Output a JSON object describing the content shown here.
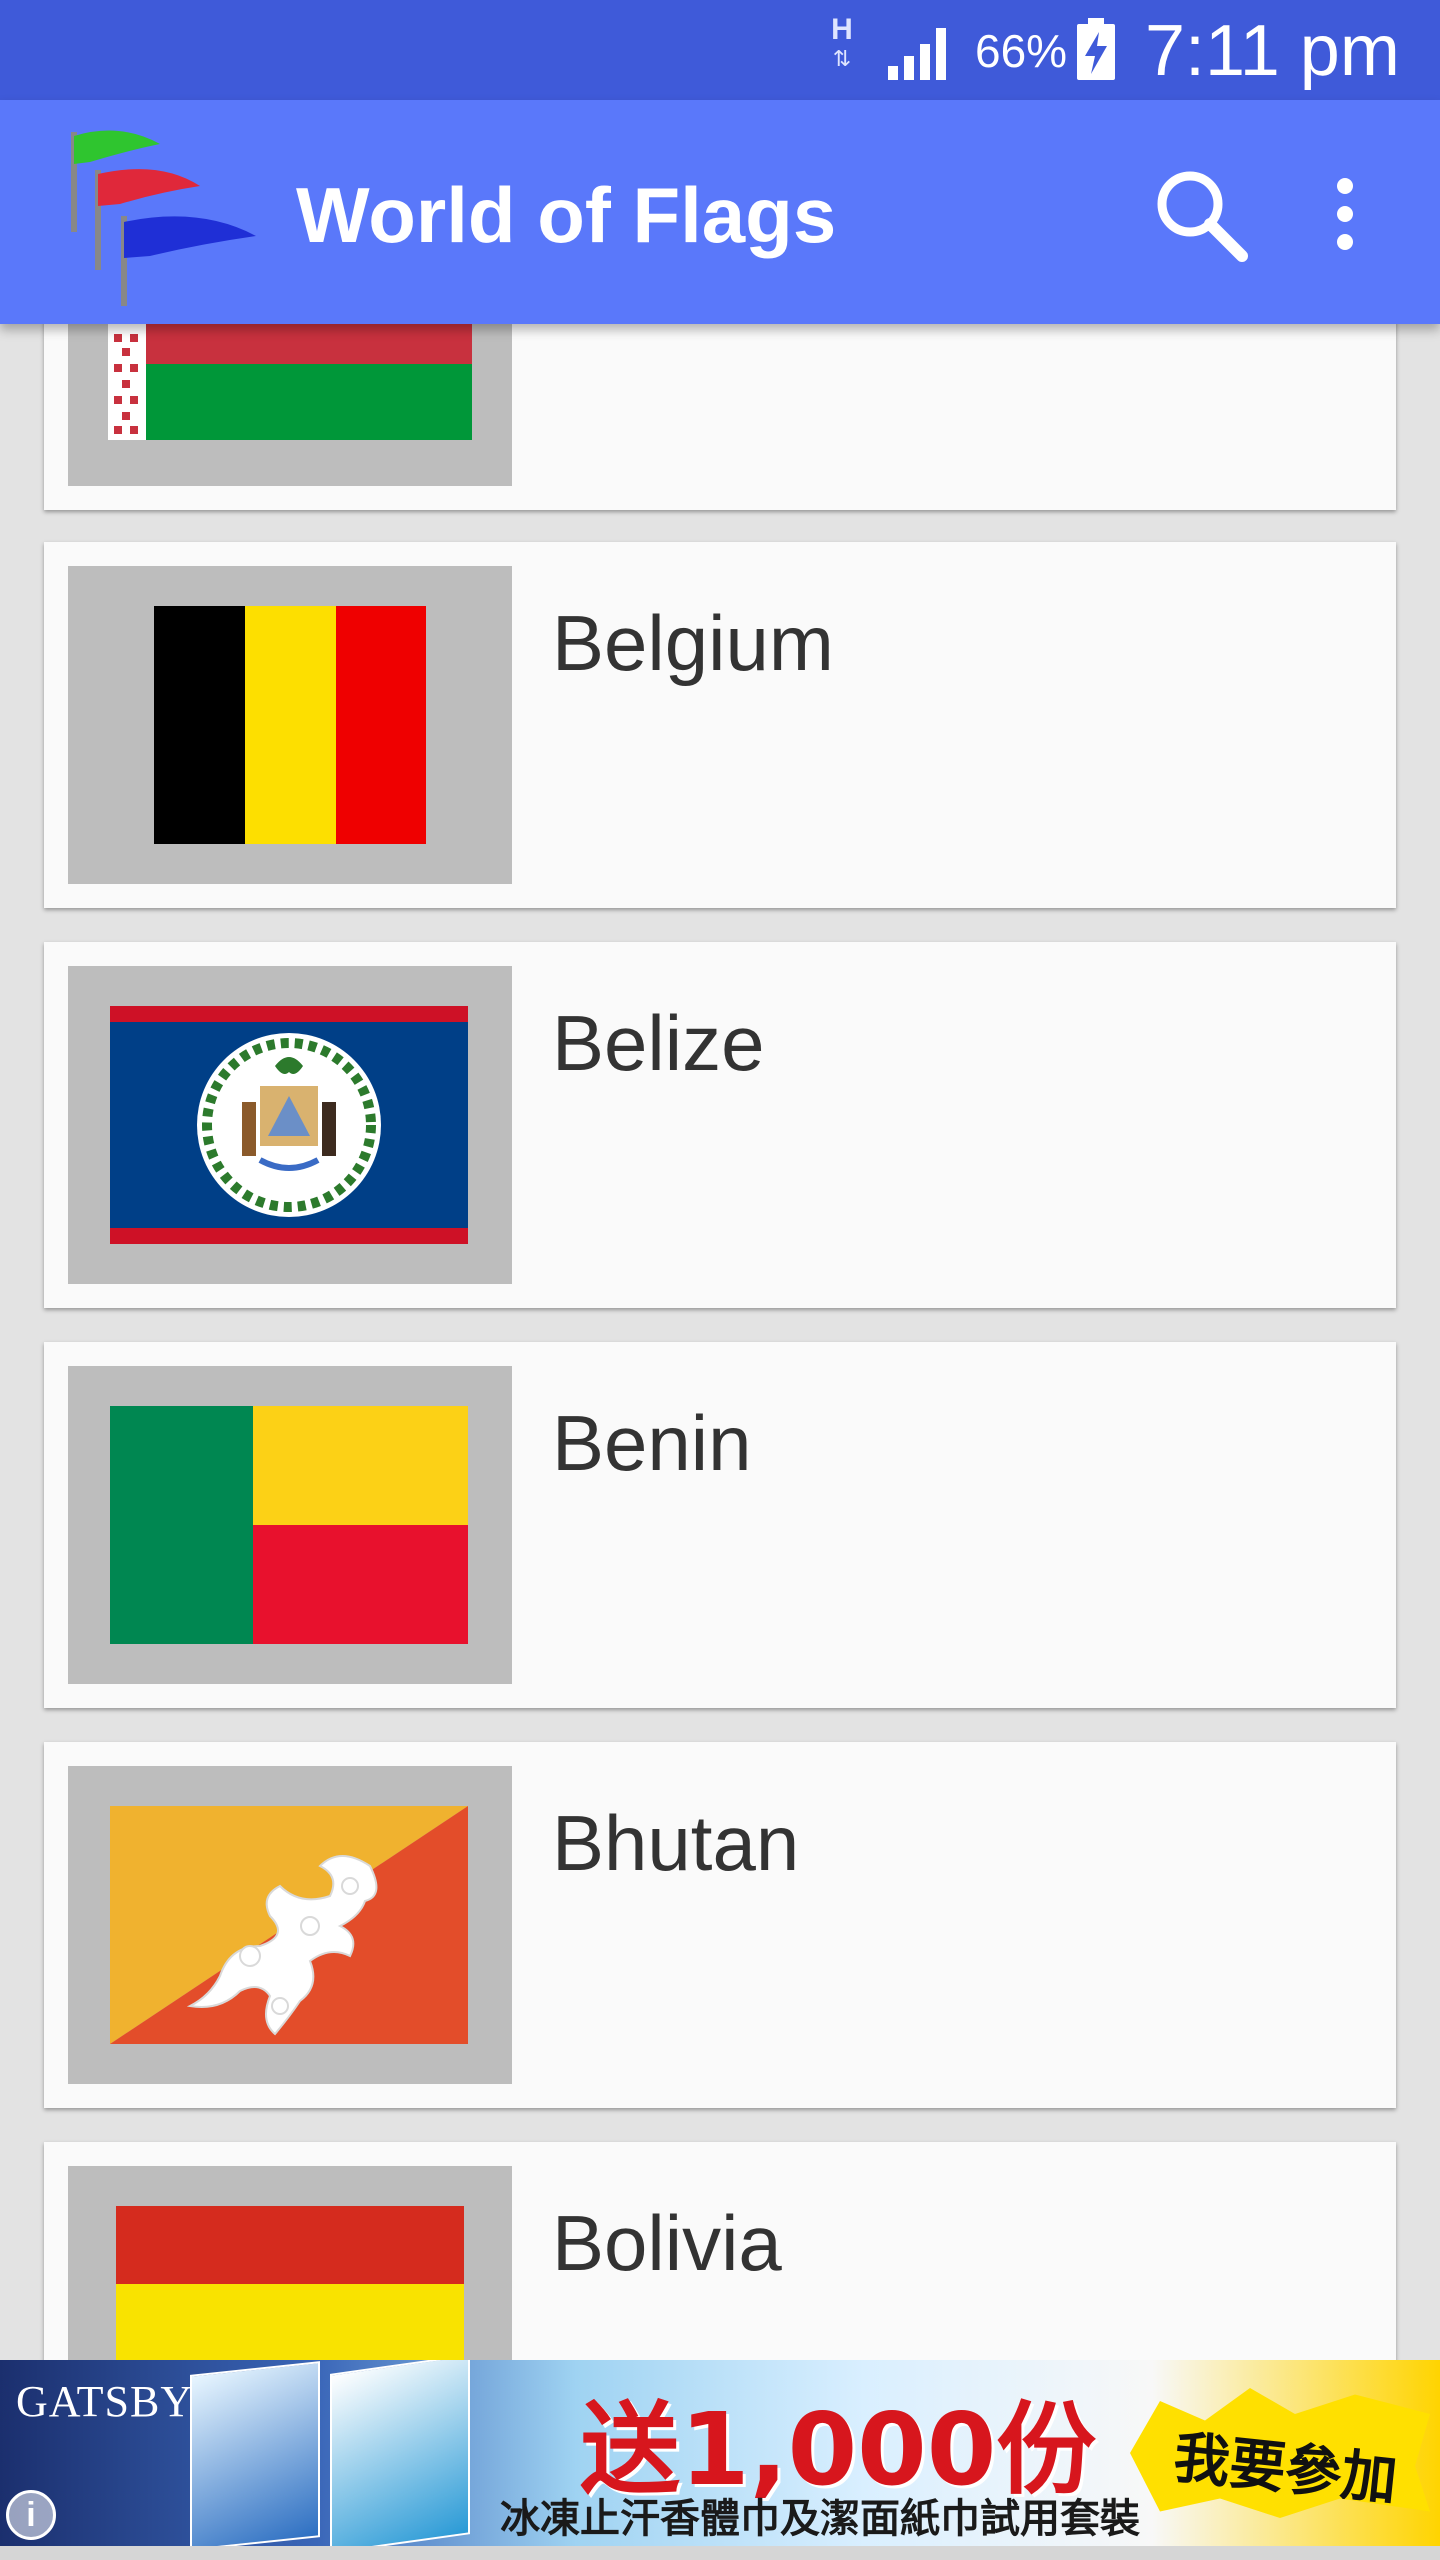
{
  "status_bar": {
    "network_type": "H",
    "battery_percent": "66%",
    "time": "7:11 pm",
    "icons": [
      "network-h-icon",
      "signal-icon",
      "battery-charging-icon"
    ]
  },
  "app_bar": {
    "title": "World of Flags",
    "logo": "flags-logo-icon",
    "actions": [
      "search-icon",
      "overflow-menu-icon"
    ],
    "color": "#5a78fa"
  },
  "countries": [
    {
      "name": "",
      "flag": "belarus"
    },
    {
      "name": "Belgium",
      "flag": "belgium"
    },
    {
      "name": "Belize",
      "flag": "belize"
    },
    {
      "name": "Benin",
      "flag": "benin"
    },
    {
      "name": "Bhutan",
      "flag": "bhutan"
    },
    {
      "name": "Bolivia",
      "flag": "bolivia"
    }
  ],
  "ad": {
    "brand": "GATSBY",
    "headline": "送1,000份",
    "subline": "冰凍止汗香體巾及潔面紙巾試用套裝",
    "cta": "我要參加",
    "info_icon": "info-icon"
  }
}
